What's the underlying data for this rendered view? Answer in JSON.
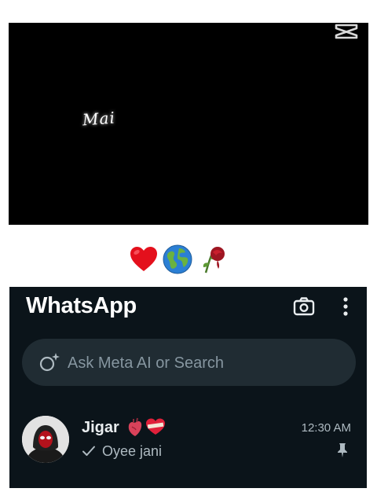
{
  "video": {
    "lyric_text": "Mai",
    "watermark_icon": "capcut-logo-icon",
    "background_color": "#000000"
  },
  "caption_emojis": [
    "red-heart-emoji",
    "globe-emoji",
    "wilted-rose-emoji"
  ],
  "whatsapp": {
    "app_title": "WhatsApp",
    "header_icons": [
      "camera-icon",
      "more-vertical-icon"
    ],
    "search": {
      "placeholder": "Ask Meta AI or Search",
      "value": "",
      "icon": "meta-ai-icon"
    },
    "chats": [
      {
        "name": "Jigar",
        "name_emojis": [
          "anatomical-heart-emoji",
          "mending-heart-emoji"
        ],
        "time": "12:30 AM",
        "status_icon": "single-check-icon",
        "preview": "Oyee jani",
        "pinned": true
      }
    ],
    "colors": {
      "background": "#0b141a",
      "search_background": "#202c33",
      "primary_text": "#e9edef",
      "secondary_text": "#aebac1"
    }
  }
}
